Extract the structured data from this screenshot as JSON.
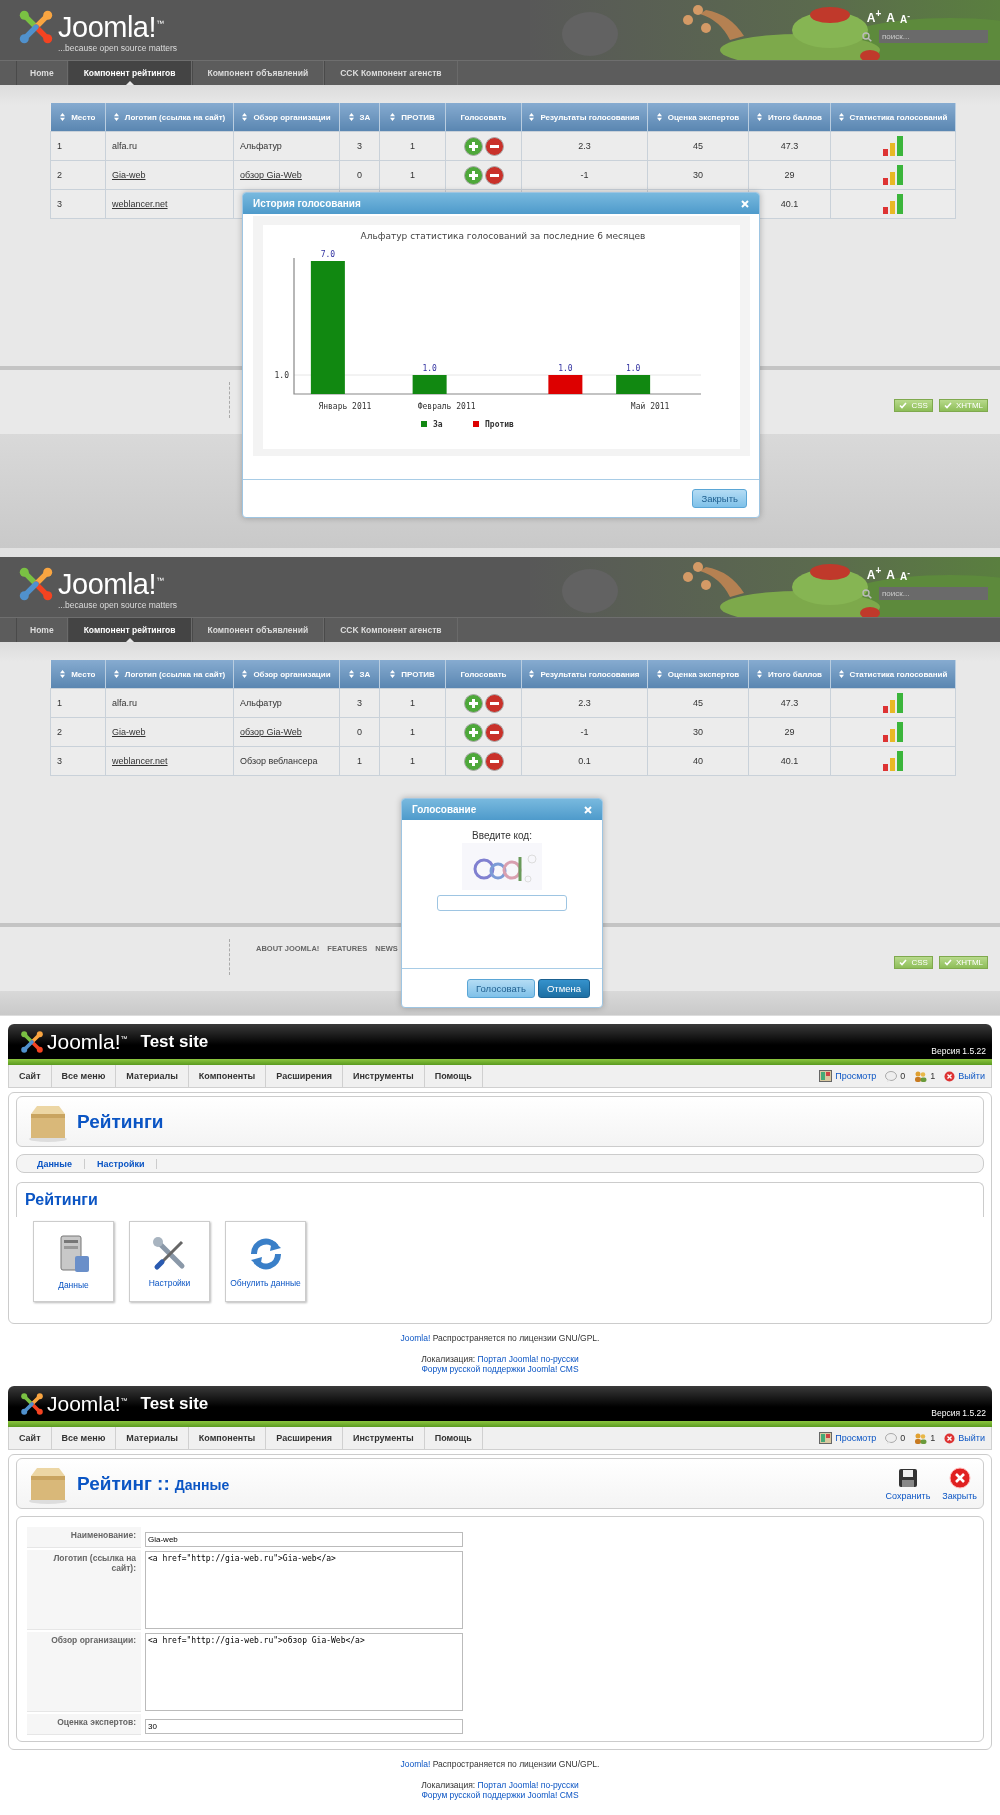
{
  "site_views": [
    {
      "logo": {
        "wordmark": "Joomla!$^{™}$",
        "tagline": "...because open source matters"
      },
      "text_size": [
        "A$^{+}$",
        "A",
        "A$^{-}$"
      ],
      "search": {
        "placeholder": "поиск..."
      },
      "nav": [
        {
          "label": "Home",
          "selected": false
        },
        {
          "label": "Компонент рейтингов",
          "selected": true
        },
        {
          "label": "Компонент объявлений",
          "selected": false
        },
        {
          "label": "CCK Компонент агенств",
          "selected": false
        }
      ],
      "table": {
        "columns": [
          {
            "label": "Место",
            "sortable": true
          },
          {
            "label": "Логотип (ссылка на сайт)",
            "sortable": true
          },
          {
            "label": "Обзор организации",
            "sortable": true
          },
          {
            "label": "ЗА",
            "sortable": true
          },
          {
            "label": "ПРОТИВ",
            "sortable": true
          },
          {
            "label": "Голосовать",
            "sortable": false
          },
          {
            "label": "Результаты голосования",
            "sortable": true
          },
          {
            "label": "Оценка экспертов",
            "sortable": true
          },
          {
            "label": "Итого баллов",
            "sortable": true
          },
          {
            "label": "Статистика голосований",
            "sortable": true
          }
        ],
        "rows": [
          {
            "place": "1",
            "logo": "alfa.ru",
            "logo_link": false,
            "review": "Альфатур",
            "review_link": false,
            "for": "3",
            "against": "1",
            "vote": true,
            "result": "2.3",
            "experts": "45",
            "total": "47.3",
            "stats": true
          },
          {
            "place": "2",
            "logo": "Gia-web",
            "logo_link": true,
            "review": "обзор Gia-Web",
            "review_link": true,
            "for": "0",
            "against": "1",
            "vote": true,
            "result": "-1",
            "experts": "30",
            "total": "29",
            "stats": true
          },
          {
            "place": "3",
            "logo": "weblancer.net",
            "logo_link": true,
            "total": "40.1",
            "stats": true
          }
        ]
      },
      "footer": {
        "badges": [
          "CSS",
          "XHTML"
        ]
      },
      "modal": {
        "kind": "chart",
        "title": "История голосования",
        "chart_data": {
          "type": "bar",
          "title": "Альфатур статистика голосований за последние 6 месяцев",
          "categories": [
            "Январь 2011",
            "Февраль 2011",
            null,
            "Май 2011"
          ],
          "series": [
            {
              "name": "За",
              "color": "#118811",
              "values": [
                7,
                1,
                null,
                1
              ]
            },
            {
              "name": "Против",
              "color": "#dd0000",
              "values": [
                null,
                null,
                1,
                null
              ]
            }
          ],
          "ylim": [
            0,
            7
          ],
          "yticks": [
            {
              "value": 1,
              "label": "1.0"
            }
          ],
          "value_labels": [
            [
              "7.0",
              "1.0",
              null,
              "1.0"
            ],
            [
              null,
              null,
              "1.0",
              null
            ]
          ],
          "legend": "bottom"
        },
        "buttons": [
          {
            "label": "Закрыть",
            "primary": false
          }
        ]
      }
    },
    {
      "logo": {
        "wordmark": "Joomla!$^{™}$",
        "tagline": "...because open source matters"
      },
      "text_size": [
        "A$^{+}$",
        "A",
        "A$^{-}$"
      ],
      "search": {
        "placeholder": "поиск..."
      },
      "nav": [
        {
          "label": "Home",
          "selected": false
        },
        {
          "label": "Компонент рейтингов",
          "selected": true
        },
        {
          "label": "Компонент объявлений",
          "selected": false
        },
        {
          "label": "CCK Компонент агенств",
          "selected": false
        }
      ],
      "table": {
        "columns": [
          {
            "label": "Место",
            "sortable": true
          },
          {
            "label": "Логотип (ссылка на сайт)",
            "sortable": true
          },
          {
            "label": "Обзор организации",
            "sortable": true
          },
          {
            "label": "ЗА",
            "sortable": true
          },
          {
            "label": "ПРОТИВ",
            "sortable": true
          },
          {
            "label": "Голосовать",
            "sortable": false
          },
          {
            "label": "Результаты голосования",
            "sortable": true
          },
          {
            "label": "Оценка экспертов",
            "sortable": true
          },
          {
            "label": "Итого баллов",
            "sortable": true
          },
          {
            "label": "Статистика голосований",
            "sortable": true
          }
        ],
        "rows": [
          {
            "place": "1",
            "logo": "alfa.ru",
            "logo_link": false,
            "review": "Альфатур",
            "review_link": false,
            "for": "3",
            "against": "1",
            "vote": true,
            "result": "2.3",
            "experts": "45",
            "total": "47.3",
            "stats": true
          },
          {
            "place": "2",
            "logo": "Gia-web",
            "logo_link": true,
            "review": "обзор Gia-Web",
            "review_link": true,
            "for": "0",
            "against": "1",
            "vote": true,
            "result": "-1",
            "experts": "30",
            "total": "29",
            "stats": true
          },
          {
            "place": "3",
            "logo": "weblancer.net",
            "logo_link": true,
            "review": "Обзор веблансера",
            "review_link": false,
            "for": "1",
            "against": "1",
            "vote": true,
            "result": "0.1",
            "experts": "40",
            "total": "40.1",
            "stats": true
          }
        ]
      },
      "footer": {
        "links": [
          "ABOUT JOOMLA!",
          "FEATURES",
          "NEWS"
        ],
        "badges": [
          "CSS",
          "XHTML"
        ]
      },
      "modal": {
        "kind": "captcha",
        "title": "Голосование",
        "prompt": "Введите код:",
        "buttons": [
          {
            "label": "Голосовать",
            "primary": false
          },
          {
            "label": "Отмена",
            "primary": true
          }
        ]
      }
    }
  ],
  "admin_views": [
    {
      "brand": {
        "wordmark": "Joomla!$^{™}$",
        "site_name": "Test site",
        "version": "Версия 1.5.22"
      },
      "menu": [
        "Сайт",
        "Все меню",
        "Материалы",
        "Компоненты",
        "Расширения",
        "Инструменты",
        "Помощь"
      ],
      "status": [
        {
          "kind": "preview",
          "label": "Просмотр"
        },
        {
          "kind": "messages",
          "label": "0"
        },
        {
          "kind": "users",
          "label": "1"
        },
        {
          "kind": "logout",
          "label": "Выйти"
        }
      ],
      "title": "Рейтинги",
      "submenu": [
        "Данные",
        "Настройки"
      ],
      "content": {
        "kind": "dashboard",
        "heading": "Рейтинги",
        "tiles": [
          {
            "kind": "data",
            "label": "Данные"
          },
          {
            "kind": "settings",
            "label": "Настройки"
          },
          {
            "kind": "reset",
            "label": "Обнулить данные"
          }
        ]
      },
      "footer": {
        "license_link": "Joomla!",
        "license_text": "Распространяется по лицензии GNU/GPL.",
        "localization_label": "Локализация:",
        "localization_link": "Портал Joomla! по-русски",
        "forum_link": "Форум русской поддержки Joomla! CMS"
      }
    },
    {
      "brand": {
        "wordmark": "Joomla!$^{™}$",
        "site_name": "Test site",
        "version": "Версия 1.5.22"
      },
      "menu": [
        "Сайт",
        "Все меню",
        "Материалы",
        "Компоненты",
        "Расширения",
        "Инструменты",
        "Помощь"
      ],
      "status": [
        {
          "kind": "preview",
          "label": "Просмотр"
        },
        {
          "kind": "messages",
          "label": "0"
        },
        {
          "kind": "users",
          "label": "1"
        },
        {
          "kind": "logout",
          "label": "Выйти"
        }
      ],
      "title": "Рейтинг ::",
      "subtitle": "Данные",
      "toolbar": [
        {
          "kind": "save",
          "label": "Сохранить"
        },
        {
          "kind": "close",
          "label": "Закрыть"
        }
      ],
      "content": {
        "kind": "form",
        "fields": [
          {
            "kind": "text",
            "label": "Наименование:",
            "value": "Gia-web"
          },
          {
            "kind": "textarea",
            "label": "Логотип (ссылка на сайт):",
            "value": "<a href=\"http://gia-web.ru\">Gia-web</a>"
          },
          {
            "kind": "textarea",
            "label": "Обзор организации:",
            "value": "<a href=\"http://gia-web.ru\">обзор Gia-Web</a>"
          },
          {
            "kind": "text",
            "label": "Оценка экспертов:",
            "value": "30"
          }
        ]
      },
      "footer": {
        "license_link": "Joomla!",
        "license_text": "Распространяется по лицензии GNU/GPL.",
        "localization_label": "Локализация:",
        "localization_link": "Портал Joomla! по-русски",
        "forum_link": "Форум русской поддержки Joomla! CMS"
      }
    }
  ]
}
